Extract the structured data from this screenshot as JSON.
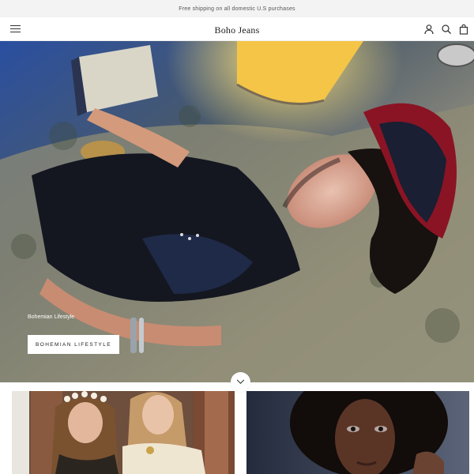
{
  "announcement": {
    "text": "Free shipping on all domestic U.S purchases"
  },
  "header": {
    "menu_icon": "hamburger-menu-icon",
    "logo": "Boho Jeans",
    "icons": [
      "account-icon",
      "search-icon",
      "cart-icon"
    ]
  },
  "hero": {
    "caption": "Bohemian Lifestyle",
    "button_label": "BOHEMIAN LIFESTYLE",
    "scroll_icon": "chevron-down-icon"
  },
  "collections": {
    "cards": [
      "card-left",
      "card-right"
    ]
  },
  "colors": {
    "text": "#1c1b1b",
    "announcement_bg": "#f3f3f3",
    "button_bg": "#ffffff"
  }
}
